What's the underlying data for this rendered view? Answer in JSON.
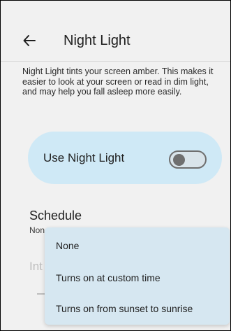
{
  "header": {
    "title": "Night Light",
    "back_icon": "arrow-back-icon"
  },
  "description": "Night Light tints your screen amber. This makes it easier to look at your screen or read in dim light, and may help you fall asleep more easily.",
  "toggle": {
    "label": "Use Night Light",
    "state": "off"
  },
  "schedule": {
    "title": "Schedule",
    "value": "Non"
  },
  "intensity": {
    "label": "Int"
  },
  "dropdown": {
    "options": [
      "None",
      "Turns on at custom time",
      "Turns on from sunset to sunrise"
    ]
  },
  "colors": {
    "background": "#f1f1f1",
    "card": "#cfe9f6",
    "menu": "#d6e7f1"
  }
}
